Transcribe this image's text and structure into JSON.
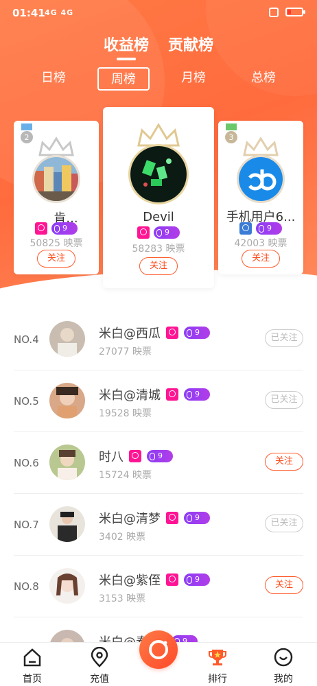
{
  "status": {
    "time": "01:41",
    "signal": "4G 4G",
    "wifi": "HD"
  },
  "top_tabs": [
    {
      "label": "收益榜",
      "active": true
    },
    {
      "label": "贡献榜",
      "active": false
    }
  ],
  "periods": [
    {
      "label": "日榜"
    },
    {
      "label": "周榜"
    },
    {
      "label": "月榜"
    },
    {
      "label": "总榜"
    }
  ],
  "active_period": "周榜",
  "podium": {
    "first": {
      "rank": "1",
      "name": "Devil",
      "level": "9",
      "tickets": "58283 映票",
      "follow": "关注",
      "gender": "female"
    },
    "second": {
      "rank": "2",
      "name": "肯...",
      "level": "9",
      "tickets": "50825 映票",
      "follow": "关注",
      "gender": "female"
    },
    "third": {
      "rank": "3",
      "name": "手机用户6...",
      "level": "9",
      "tickets": "42003 映票",
      "follow": "关注",
      "gender": "male"
    }
  },
  "list": [
    {
      "rank": "NO.4",
      "name": "米白@西瓜",
      "level": "9",
      "tickets": "27077 映票",
      "button": "已关注",
      "followed": true
    },
    {
      "rank": "NO.5",
      "name": "米白@清城",
      "level": "9",
      "tickets": "19528 映票",
      "button": "已关注",
      "followed": true
    },
    {
      "rank": "NO.6",
      "name": "时八",
      "level": "9",
      "tickets": "15724 映票",
      "button": "关注",
      "followed": false
    },
    {
      "rank": "NO.7",
      "name": "米白@清梦",
      "level": "9",
      "tickets": "3402 映票",
      "button": "已关注",
      "followed": true
    },
    {
      "rank": "NO.8",
      "name": "米白@紫侄",
      "level": "9",
      "tickets": "3153 映票",
      "button": "关注",
      "followed": false
    },
    {
      "rank": "",
      "name": "米白@春",
      "level": "9",
      "tickets": "",
      "button": "",
      "followed": false
    }
  ],
  "tabbar": [
    {
      "label": "首页",
      "icon": "home-icon"
    },
    {
      "label": "充值",
      "icon": "location-icon"
    },
    {
      "label": "",
      "icon": "camera-icon"
    },
    {
      "label": "排行",
      "icon": "trophy-icon"
    },
    {
      "label": "我的",
      "icon": "smile-icon"
    }
  ],
  "colors": {
    "accent": "#ff6b3d",
    "level": "#9b3df0",
    "gender_female": "#ff1493",
    "gender_male": "#3a7bd5"
  }
}
